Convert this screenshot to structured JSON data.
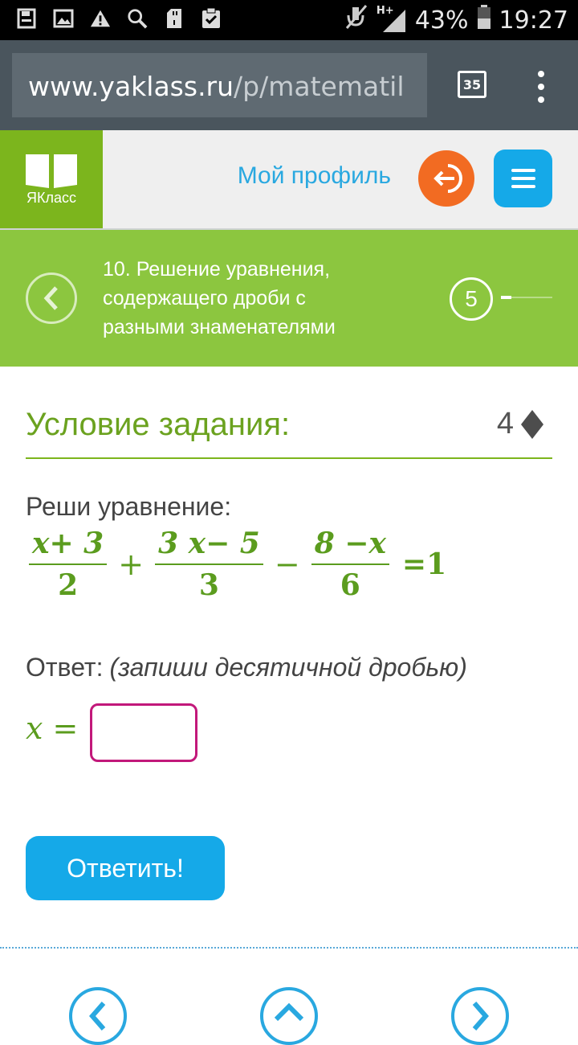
{
  "status_bar": {
    "icons": [
      "save-icon",
      "image-icon",
      "warning-icon",
      "search-icon",
      "sd-card-icon",
      "clipboard-check-icon"
    ],
    "network": "H+",
    "battery": "43%",
    "time": "19:27"
  },
  "browser": {
    "url_host": "www.yaklass.ru",
    "url_path": "/p/matematil",
    "tab_count": "35"
  },
  "header": {
    "logo_text": "ЯКласс",
    "profile_link": "Мой профиль"
  },
  "lesson": {
    "title": "10. Решение уравнения, содержащего дроби с разными знаменателями",
    "step": "5"
  },
  "task": {
    "section_title": "Условие задания:",
    "points": "4",
    "prompt": "Реши уравнение:",
    "equation": {
      "frac1": {
        "num": "x+ 3",
        "den": "2"
      },
      "op1": "+",
      "frac2": {
        "num": "3 x− 5",
        "den": "3"
      },
      "op2": "−",
      "frac3": {
        "num": "8 −x",
        "den": "6"
      },
      "rhs": "=1"
    },
    "answer_label": "Ответ:",
    "answer_note": "(запиши десятичной дробью)",
    "variable": "x =",
    "answer_value": ""
  },
  "submit_label": "Ответить!",
  "colors": {
    "accent_green": "#8cc63f",
    "text_green": "#5b9c1e",
    "blue": "#15a9e8",
    "orange": "#f26b22",
    "input_border": "#c2187a"
  }
}
